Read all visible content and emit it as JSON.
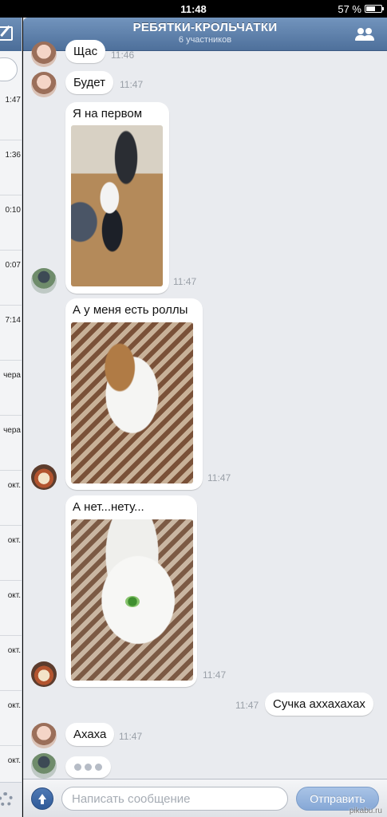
{
  "status_bar": {
    "time": "11:48",
    "battery": "57 %"
  },
  "sidebar": {
    "items": [
      "1:47",
      "1:36",
      "0:10",
      "0:07",
      "7:14",
      "чера",
      "чера",
      "окт.",
      "окт.",
      "окт.",
      "окт.",
      "окт.",
      "окт."
    ]
  },
  "chat": {
    "title": "РЕБЯТКИ-КРОЛЬЧАТКИ",
    "subtitle": "6 участников",
    "messages": [
      {
        "text": "Щас",
        "time": "11:46"
      },
      {
        "text": "Будет",
        "time": "11:47"
      },
      {
        "text": "Я на первом",
        "time": "11:47",
        "photo": true
      },
      {
        "text": "А у меня есть роллы",
        "time": "11:47",
        "photo": true
      },
      {
        "text": "А нет...нету...",
        "time": "11:47",
        "photo": true
      },
      {
        "text": "Сучка аххахахах",
        "time": "11:47",
        "outgoing": true
      },
      {
        "text": "Ахаха",
        "time": "11:47"
      }
    ]
  },
  "input": {
    "placeholder": "Написать сообщение",
    "send_label": "Отправить"
  },
  "watermark": "pikabu.ru"
}
